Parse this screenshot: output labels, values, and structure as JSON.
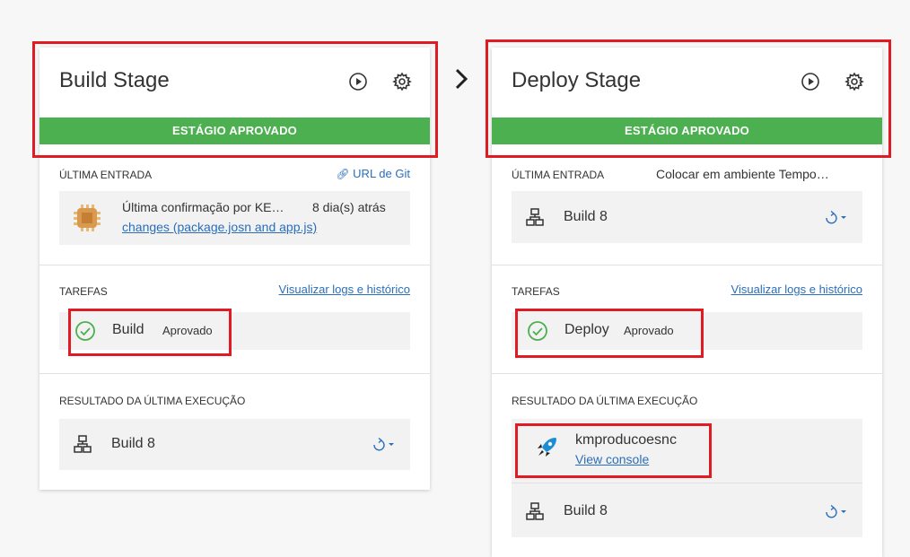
{
  "build_stage": {
    "title": "Build Stage",
    "status": "ESTÁGIO APROVADO",
    "last_entry_label": "ÚLTIMA ENTRADA",
    "git_link": "URL de Git",
    "commit_text": "Última confirmação por KE…",
    "commit_time": "8 dia(s) atrás",
    "commit_link": "changes (package.josn and app.js)",
    "tasks_label": "TAREFAS",
    "logs_link": "Visualizar logs e histórico",
    "task_name": "Build",
    "task_status": "Aprovado",
    "result_label": "RESULTADO DA ÚLTIMA EXECUÇÃO",
    "result_build": "Build 8"
  },
  "deploy_stage": {
    "title": "Deploy Stage",
    "status": "ESTÁGIO APROVADO",
    "last_entry_label": "ÚLTIMA ENTRADA",
    "last_entry_value": "Colocar em ambiente Tempo…",
    "entry_build": "Build 8",
    "tasks_label": "TAREFAS",
    "logs_link": "Visualizar logs e histórico",
    "task_name": "Deploy",
    "task_status": "Aprovado",
    "result_label": "RESULTADO DA ÚLTIMA EXECUÇÃO",
    "app_name": "kmproducoesnc",
    "console_link": "View console",
    "result_build": "Build 8"
  },
  "colors": {
    "approved": "#4caf50",
    "link": "#2a6ebb",
    "highlight": "#e01b24"
  }
}
